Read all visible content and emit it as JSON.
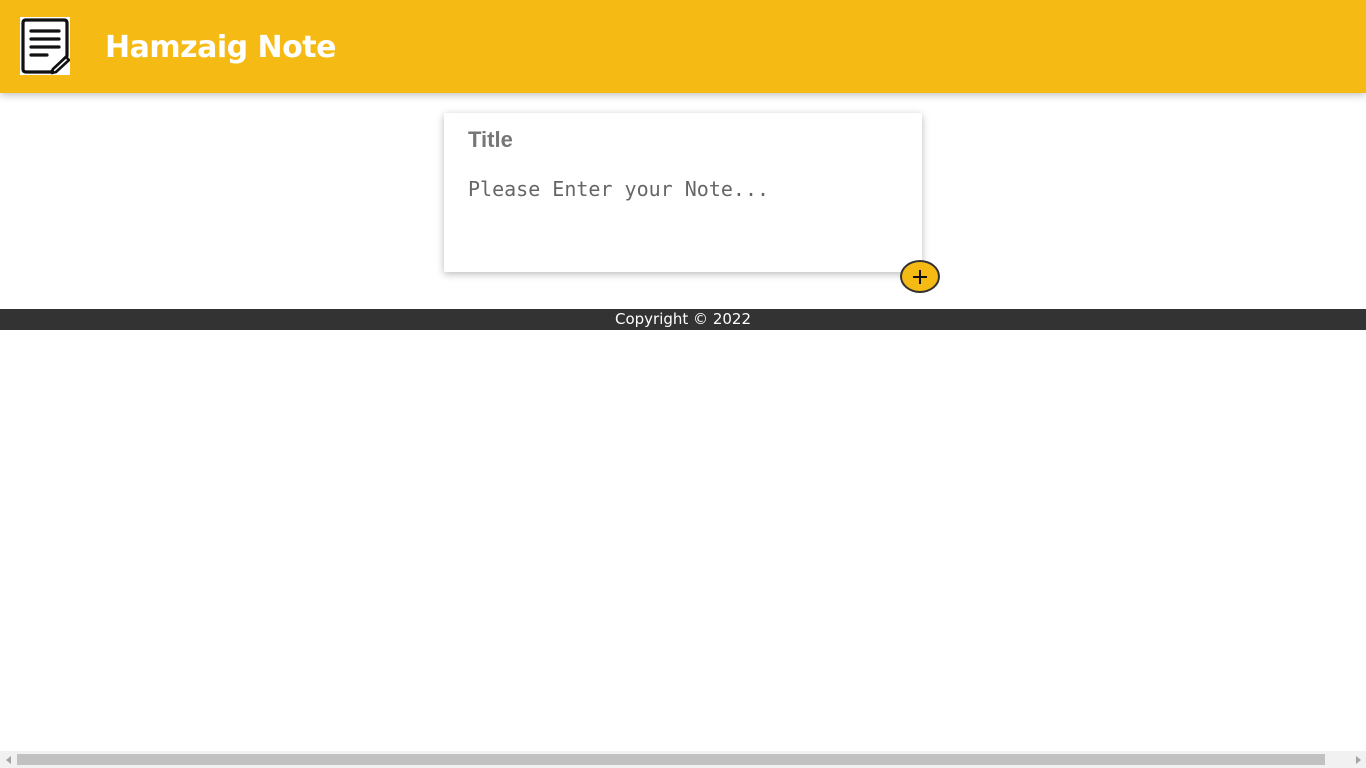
{
  "header": {
    "title": "Hamzaig Note",
    "logo_icon": "note-document-icon",
    "background_color": "#f5ba13"
  },
  "note_form": {
    "title_placeholder": "Title",
    "content_placeholder": "Please Enter your Note...",
    "add_button_icon": "plus-icon",
    "accent_color": "#f5ba13"
  },
  "footer": {
    "text": "Copyright © 2022",
    "background_color": "#333333"
  },
  "scrollbar": {
    "left_icon": "chevron-left-icon",
    "right_icon": "chevron-right-icon"
  }
}
